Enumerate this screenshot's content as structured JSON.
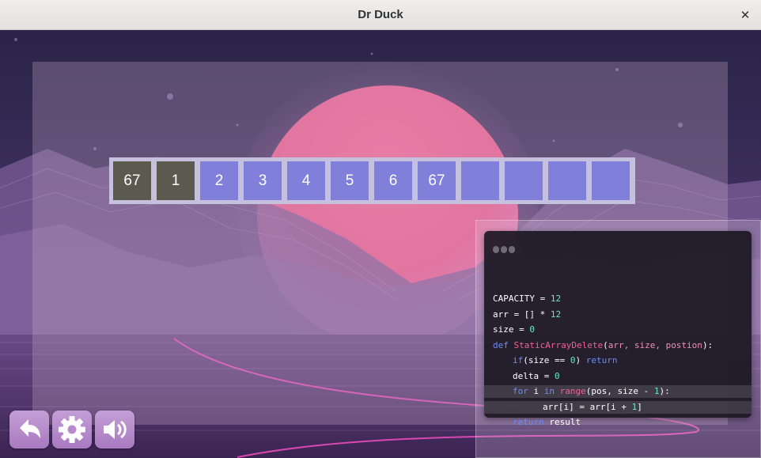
{
  "window": {
    "title": "Dr Duck",
    "close_label": "✕"
  },
  "array": {
    "cells": [
      {
        "value": "67",
        "state": "removed"
      },
      {
        "value": "1",
        "state": "removed"
      },
      {
        "value": "2",
        "state": "active"
      },
      {
        "value": "3",
        "state": "active"
      },
      {
        "value": "4",
        "state": "active"
      },
      {
        "value": "5",
        "state": "active"
      },
      {
        "value": "6",
        "state": "active"
      },
      {
        "value": "67",
        "state": "active"
      },
      {
        "value": "",
        "state": "empty"
      },
      {
        "value": "",
        "state": "empty"
      },
      {
        "value": "",
        "state": "empty"
      },
      {
        "value": "",
        "state": "empty"
      }
    ]
  },
  "code": {
    "lines": [
      {
        "indent": 0,
        "highlight": false,
        "tokens": [
          {
            "text": "CAPACITY",
            "c": "plain"
          },
          {
            "text": " = ",
            "c": "op"
          },
          {
            "text": "12",
            "c": "num"
          }
        ]
      },
      {
        "indent": 0,
        "highlight": false,
        "tokens": [
          {
            "text": "arr",
            "c": "plain"
          },
          {
            "text": " = ",
            "c": "op"
          },
          {
            "text": "[]",
            "c": "plain"
          },
          {
            "text": " * ",
            "c": "op"
          },
          {
            "text": "12",
            "c": "num"
          }
        ]
      },
      {
        "indent": 0,
        "highlight": false,
        "tokens": [
          {
            "text": "size",
            "c": "plain"
          },
          {
            "text": " = ",
            "c": "op"
          },
          {
            "text": "0",
            "c": "num"
          }
        ]
      },
      {
        "indent": 0,
        "highlight": false,
        "tokens": [
          {
            "text": "def",
            "c": "kw"
          },
          {
            "text": " ",
            "c": "plain"
          },
          {
            "text": "StaticArrayDelete",
            "c": "fn"
          },
          {
            "text": "(",
            "c": "plain"
          },
          {
            "text": "arr, size, postion",
            "c": "param"
          },
          {
            "text": "):",
            "c": "plain"
          }
        ]
      },
      {
        "indent": 1,
        "highlight": false,
        "tokens": [
          {
            "text": "if",
            "c": "kw"
          },
          {
            "text": "(size ",
            "c": "plain"
          },
          {
            "text": "==",
            "c": "op"
          },
          {
            "text": " ",
            "c": "plain"
          },
          {
            "text": "0",
            "c": "num"
          },
          {
            "text": ") ",
            "c": "plain"
          },
          {
            "text": "return",
            "c": "kw"
          }
        ]
      },
      {
        "indent": 1,
        "highlight": false,
        "tokens": [
          {
            "text": "delta",
            "c": "plain"
          },
          {
            "text": " = ",
            "c": "op"
          },
          {
            "text": "0",
            "c": "num"
          }
        ]
      },
      {
        "indent": 1,
        "highlight": true,
        "tokens": [
          {
            "text": "for",
            "c": "kw"
          },
          {
            "text": " i ",
            "c": "plain"
          },
          {
            "text": "in",
            "c": "kw"
          },
          {
            "text": " ",
            "c": "plain"
          },
          {
            "text": "range",
            "c": "fn"
          },
          {
            "text": "(pos, size ",
            "c": "plain"
          },
          {
            "text": "-",
            "c": "op"
          },
          {
            "text": " ",
            "c": "plain"
          },
          {
            "text": "1",
            "c": "num"
          },
          {
            "text": "):",
            "c": "plain"
          }
        ]
      },
      {
        "indent": 2,
        "highlight": true,
        "tokens": [
          {
            "text": "arr[i]",
            "c": "plain"
          },
          {
            "text": " = ",
            "c": "op"
          },
          {
            "text": "arr[i ",
            "c": "plain"
          },
          {
            "text": "+",
            "c": "op"
          },
          {
            "text": " ",
            "c": "plain"
          },
          {
            "text": "1",
            "c": "num"
          },
          {
            "text": "]",
            "c": "plain"
          }
        ]
      },
      {
        "indent": 1,
        "highlight": false,
        "tokens": [
          {
            "text": "return",
            "c": "kw"
          },
          {
            "text": " result",
            "c": "plain"
          }
        ]
      }
    ]
  },
  "syntax_colors": {
    "plain": "#ffffff",
    "op": "#ffffff",
    "num": "#6ee6c0",
    "kw": "#6d8cf5",
    "fn": "#f06292",
    "param": "#f48fb1"
  },
  "colors": {
    "cell_active": "#8080db",
    "cell_removed": "#5a5a4e",
    "array_frame": "#c4c0dd",
    "button_bg": "#b88ccc"
  },
  "buttons": [
    {
      "name": "back-button",
      "icon": "back-arrow-icon"
    },
    {
      "name": "settings-button",
      "icon": "gear-icon"
    },
    {
      "name": "sound-button",
      "icon": "speaker-icon"
    }
  ]
}
